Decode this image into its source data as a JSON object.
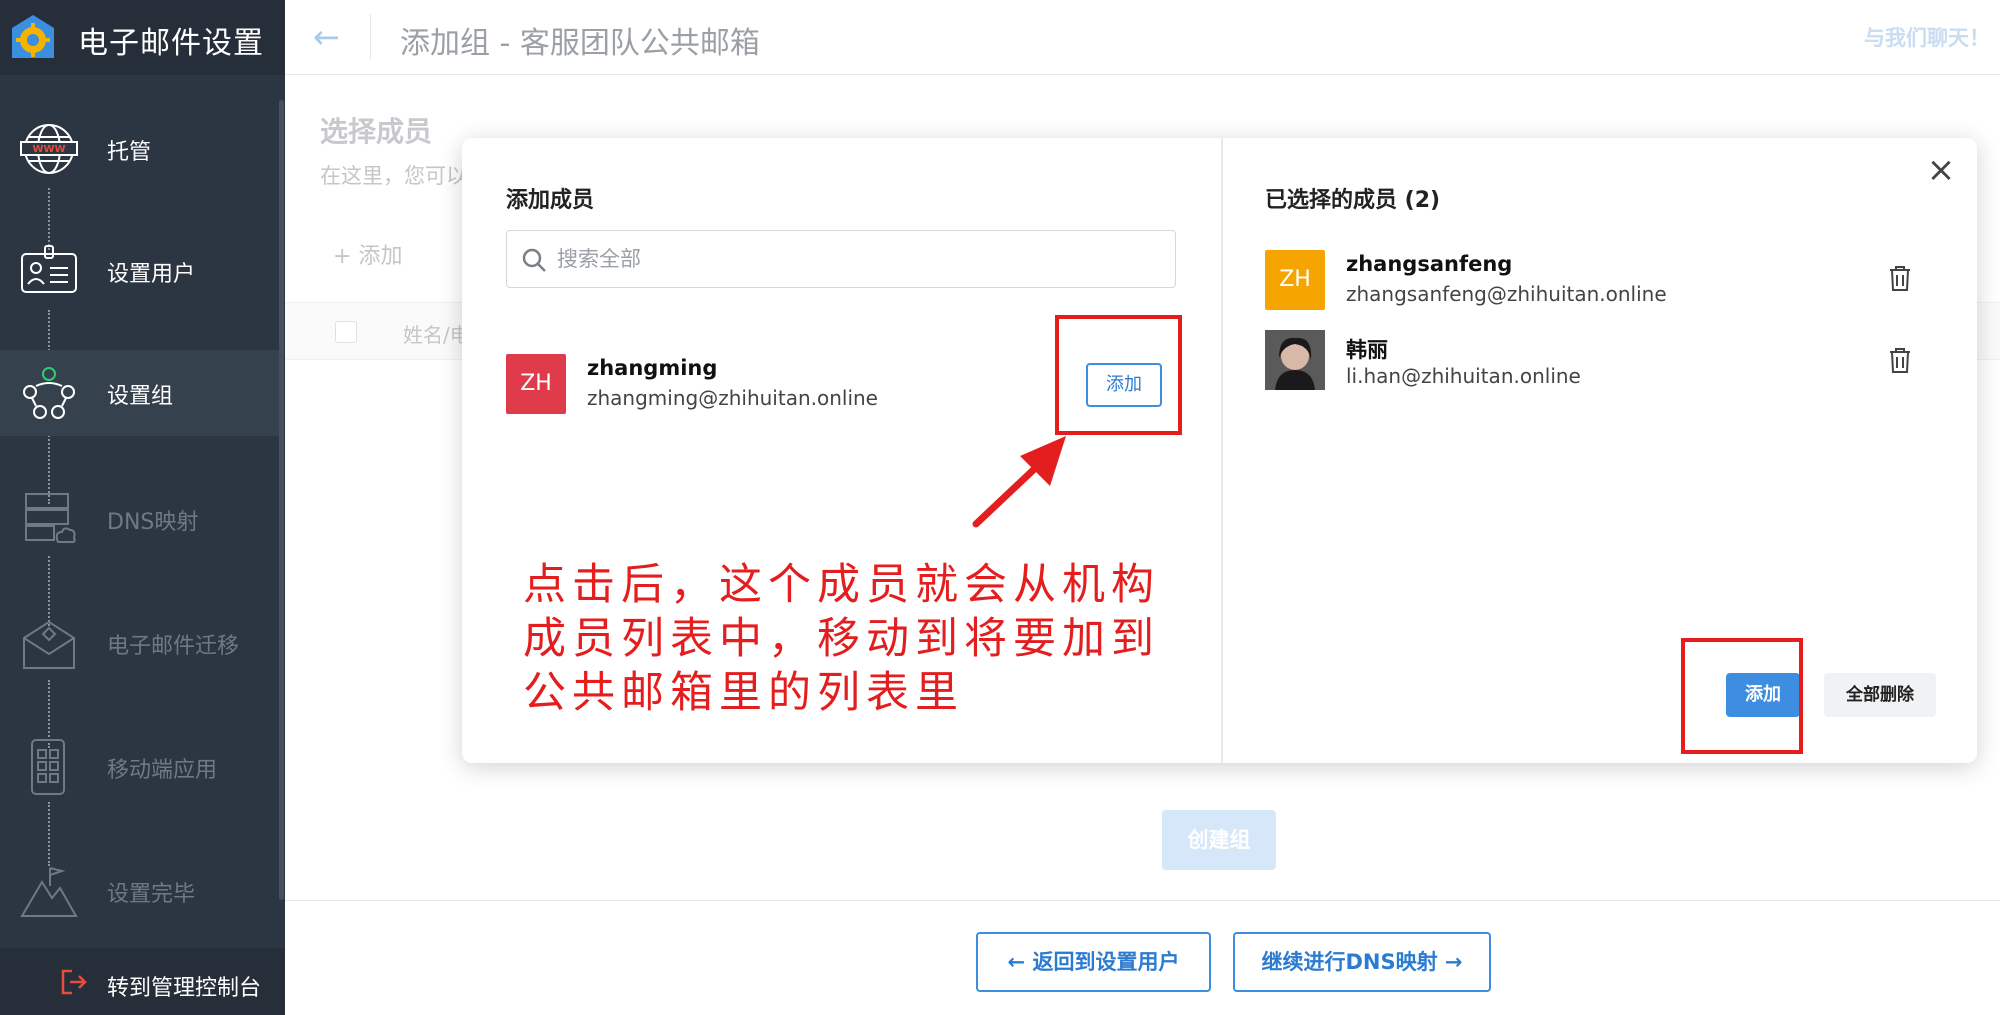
{
  "sidebar": {
    "app_title": "电子邮件设置",
    "items": [
      {
        "label": "托管",
        "icon": "globe-www-icon",
        "state": "done"
      },
      {
        "label": "设置用户",
        "icon": "user-card-icon",
        "state": "done"
      },
      {
        "label": "设置组",
        "icon": "group-network-icon",
        "state": "active"
      },
      {
        "label": "DNS映射",
        "icon": "server-cloud-icon",
        "state": "pending"
      },
      {
        "label": "电子邮件迁移",
        "icon": "mail-migration-icon",
        "state": "pending"
      },
      {
        "label": "移动端应用",
        "icon": "mobile-apps-icon",
        "state": "pending"
      },
      {
        "label": "设置完毕",
        "icon": "mountain-flag-icon",
        "state": "pending"
      }
    ],
    "console_link": "转到管理控制台"
  },
  "header": {
    "page_title": "添加组 - 客服团队公共邮箱",
    "chat_link": "与我们聊天！"
  },
  "main": {
    "section_title": "选择成员",
    "section_desc": "在这里，您可以",
    "add_link": "添加",
    "table_col_name": "姓名/电",
    "create_button": "创建组",
    "back_button": "←  返回到设置用户",
    "next_button": "继续进行DNS映射  →"
  },
  "modal": {
    "left_title": "添加成员",
    "search_placeholder": "搜索全部",
    "available": [
      {
        "initials": "ZH",
        "name": "zhangming",
        "email": "zhangming@zhihuitan.online",
        "color": "#e03b4b",
        "action": "添加"
      }
    ],
    "right_title": "已选择的成员 (2)",
    "selected": [
      {
        "initials": "ZH",
        "name": "zhangsanfeng",
        "email": "zhangsanfeng@zhihuitan.online",
        "color": "#f5a400"
      },
      {
        "initials": "",
        "name": "韩丽",
        "email": "li.han@zhihuitan.online",
        "color": "#3a3a3a"
      }
    ],
    "add_button": "添加",
    "delete_all_button": "全部删除"
  },
  "annotation": {
    "line1": "点击后，这个成员就会从机构",
    "line2": "成员列表中，移动到将要加到",
    "line3": "公共邮箱里的列表里",
    "color": "#e41e1e"
  },
  "colors": {
    "sidebar_bg": "#2c3642",
    "primary": "#3d8de0"
  }
}
